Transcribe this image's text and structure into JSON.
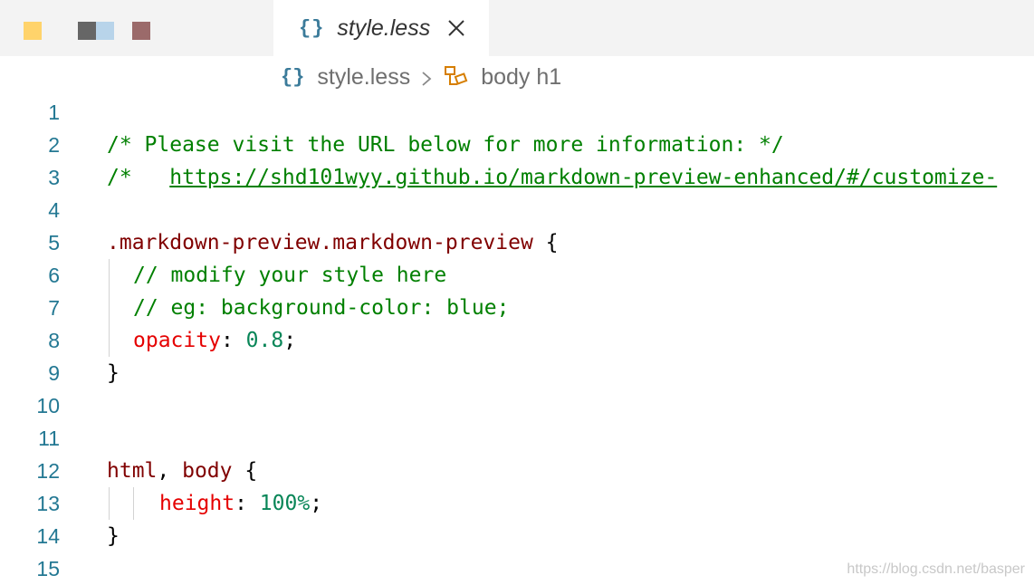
{
  "tab": {
    "icon": "{}",
    "label": "style.less"
  },
  "breadcrumb": {
    "file_icon": "{}",
    "file": "style.less",
    "symbol": "body h1"
  },
  "lines": [
    {
      "n": "1"
    },
    {
      "n": "2"
    },
    {
      "n": "3"
    },
    {
      "n": "4"
    },
    {
      "n": "5"
    },
    {
      "n": "6"
    },
    {
      "n": "7"
    },
    {
      "n": "8"
    },
    {
      "n": "9"
    },
    {
      "n": "10"
    },
    {
      "n": "11"
    },
    {
      "n": "12"
    },
    {
      "n": "13"
    },
    {
      "n": "14"
    },
    {
      "n": "15"
    }
  ],
  "code": {
    "l2": "/* Please visit the URL below for more information: */",
    "l3_prefix": "/*   ",
    "l3_url": "https://shd101wyy.github.io/markdown-preview-enhanced/#/customize-",
    "l5_sel": ".markdown-preview.markdown-preview",
    "l5_brace": " {",
    "l6": "// modify your style here",
    "l7": "// eg: background-color: blue;",
    "l8_prop": "opacity",
    "l8_colon": ": ",
    "l8_val": "0.8",
    "l8_semi": ";",
    "l9": "}",
    "l12_a": "html",
    "l12_b": ", ",
    "l12_c": "body",
    "l12_d": " {",
    "l13_prop": "height",
    "l13_colon": ": ",
    "l13_val": "100%",
    "l13_semi": ";",
    "l14": "}"
  },
  "watermark": "https://blog.csdn.net/basper",
  "colors": {
    "line_number": "#237893",
    "comment": "#008000",
    "selector": "#800000",
    "property": "#e50000",
    "number": "#098658"
  }
}
